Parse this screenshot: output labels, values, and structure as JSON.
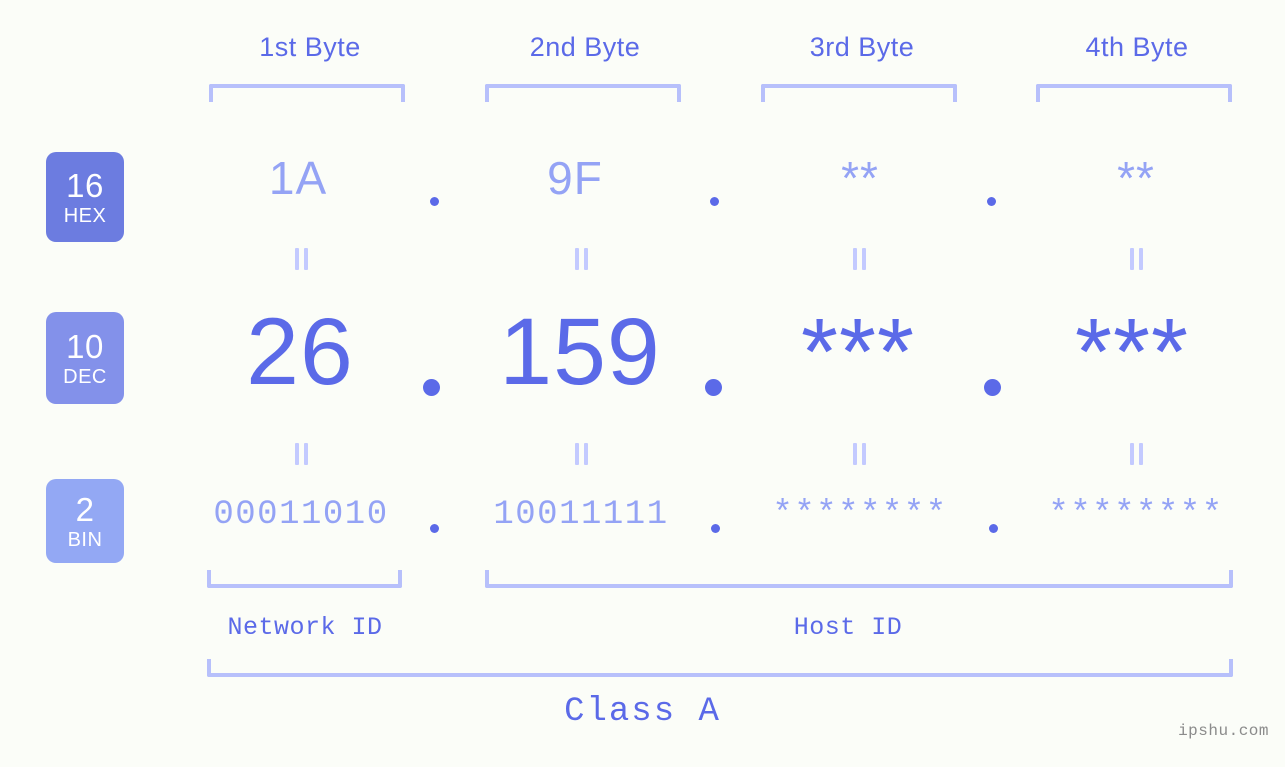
{
  "watermark": "ipshu.com",
  "colors": {
    "background": "#fbfdf8",
    "accent_strong": "#5b6ae8",
    "accent_light": "#94a3f5",
    "bracket": "#b7c0fb",
    "connector": "#c3caff",
    "badge_hex": "#6c7ce0",
    "badge_dec": "#8391ea",
    "badge_bin": "#93a8f4",
    "watermark": "#8b8b8b"
  },
  "byte_headers": [
    {
      "label": "1st Byte"
    },
    {
      "label": "2nd Byte"
    },
    {
      "label": "3rd Byte"
    },
    {
      "label": "4th Byte"
    }
  ],
  "badges": [
    {
      "number": "16",
      "name": "HEX"
    },
    {
      "number": "10",
      "name": "DEC"
    },
    {
      "number": "2",
      "name": "BIN"
    }
  ],
  "rows": {
    "hex": {
      "values": [
        "1A",
        "9F",
        "**",
        "**"
      ]
    },
    "dec": {
      "values": [
        "26",
        "159",
        "***",
        "***"
      ]
    },
    "bin": {
      "values": [
        "00011010",
        "10011111",
        "********",
        "********"
      ]
    }
  },
  "separator": ".",
  "connectors": {
    "symbol": "||"
  },
  "sections": [
    {
      "label": "Network ID"
    },
    {
      "label": "Host ID"
    }
  ],
  "class": {
    "label": "Class A"
  }
}
